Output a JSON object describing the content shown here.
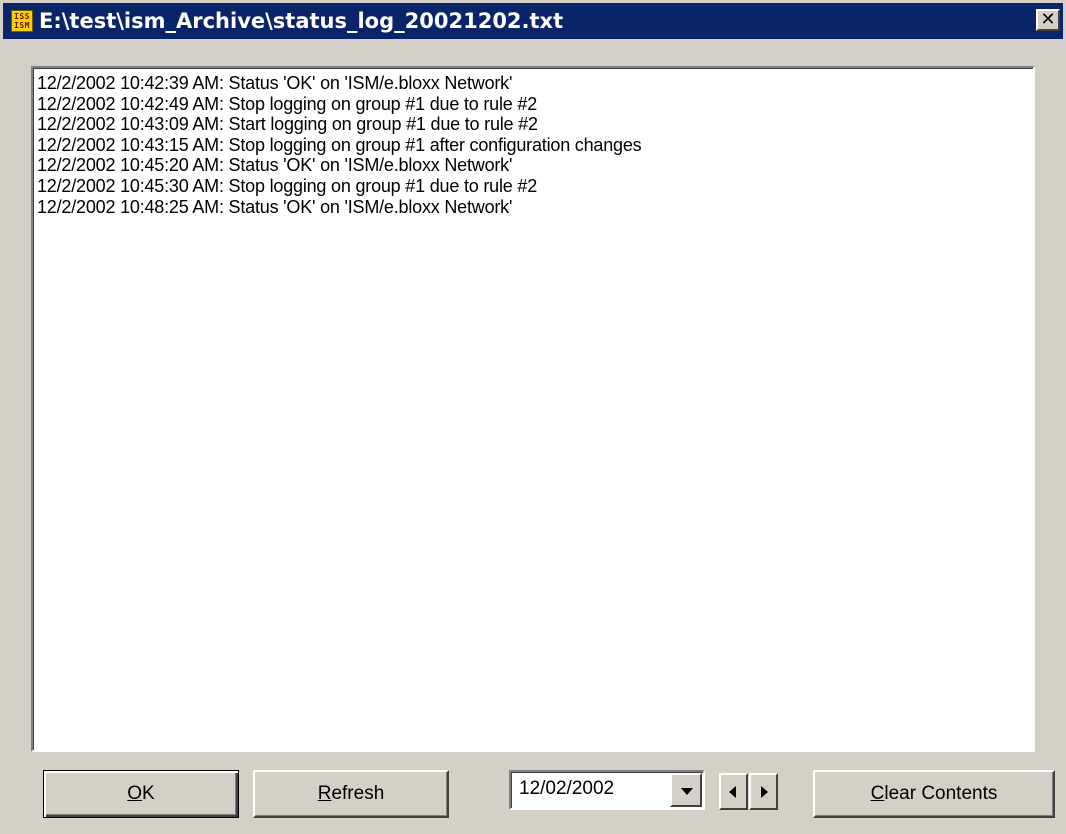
{
  "window": {
    "title": "E:\\test\\ism_Archive\\status_log_20021202.txt",
    "icon": "app-icon",
    "close_glyph": "✕"
  },
  "log": {
    "lines": [
      "12/2/2002 10:42:39 AM: Status 'OK' on 'ISM/e.bloxx Network'",
      "12/2/2002 10:42:49 AM: Stop logging on group #1 due to rule #2",
      "12/2/2002 10:43:09 AM: Start logging on group #1 due to rule #2",
      "12/2/2002 10:43:15 AM: Stop logging on group #1 after configuration changes",
      "12/2/2002 10:45:20 AM: Status 'OK' on 'ISM/e.bloxx Network'",
      "12/2/2002 10:45:30 AM: Stop logging on group #1 due to rule #2",
      "12/2/2002 10:48:25 AM: Status 'OK' on 'ISM/e.bloxx Network'"
    ]
  },
  "buttons": {
    "ok": {
      "mnemonic": "O",
      "rest": "K"
    },
    "refresh": {
      "mnemonic": "R",
      "rest": "efresh"
    },
    "clear": {
      "mnemonic": "C",
      "rest": "lear Contents"
    }
  },
  "date_picker": {
    "value": "12/02/2002"
  },
  "colors": {
    "titlebar": "#0a246a",
    "face": "#d4d0c8"
  }
}
